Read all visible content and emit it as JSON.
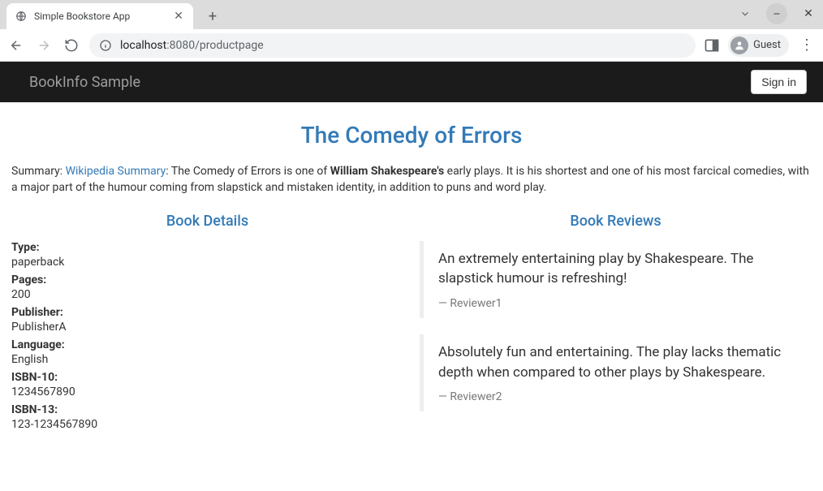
{
  "browser": {
    "tab_title": "Simple Bookstore App",
    "url_host": "localhost",
    "url_port_path": ":8080/productpage",
    "guest_label": "Guest"
  },
  "navbar": {
    "brand": "BookInfo Sample",
    "signin_label": "Sign in"
  },
  "product": {
    "title": "The Comedy of Errors",
    "summary_prefix": "Summary: ",
    "summary_link_text": "Wikipedia Summary",
    "summary_sep": ": The Comedy of Errors is one of ",
    "summary_bold": "William Shakespeare's",
    "summary_rest": " early plays. It is his shortest and one of his most farcical comedies, with a major part of the humour coming from slapstick and mistaken identity, in addition to puns and word play."
  },
  "details": {
    "heading": "Book Details",
    "items": [
      {
        "label": "Type:",
        "value": "paperback"
      },
      {
        "label": "Pages:",
        "value": "200"
      },
      {
        "label": "Publisher:",
        "value": "PublisherA"
      },
      {
        "label": "Language:",
        "value": "English"
      },
      {
        "label": "ISBN-10:",
        "value": "1234567890"
      },
      {
        "label": "ISBN-13:",
        "value": "123-1234567890"
      }
    ]
  },
  "reviews": {
    "heading": "Book Reviews",
    "items": [
      {
        "text": "An extremely entertaining play by Shakespeare. The slapstick humour is refreshing!",
        "reviewer": "Reviewer1"
      },
      {
        "text": "Absolutely fun and entertaining. The play lacks thematic depth when compared to other plays by Shakespeare.",
        "reviewer": "Reviewer2"
      }
    ]
  }
}
